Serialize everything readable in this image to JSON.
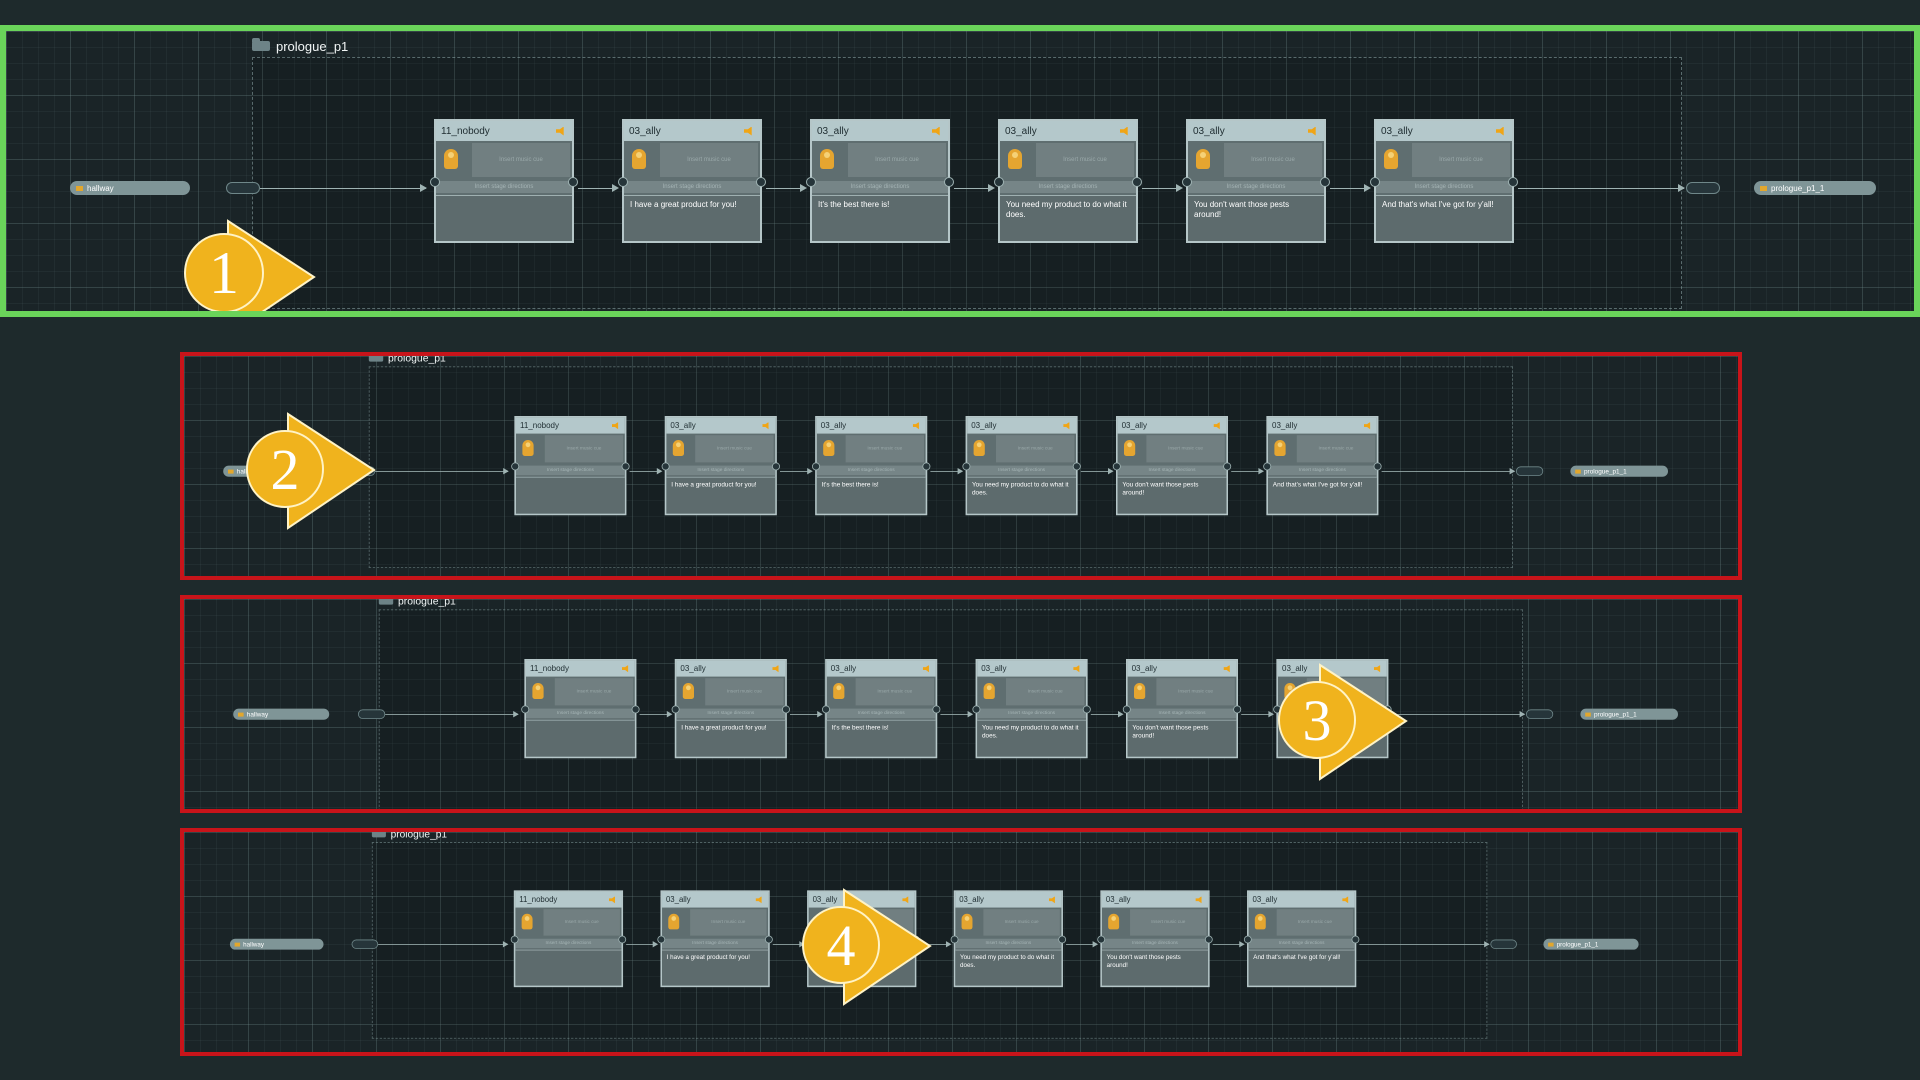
{
  "graph": {
    "group_name": "prologue_p1",
    "start_pill": "hallway",
    "end_pill": "prologue_p1_1",
    "music_placeholder": "Insert music cue",
    "stage_placeholder": "Insert stage directions",
    "nodes": [
      {
        "speaker": "11_nobody",
        "text": ""
      },
      {
        "speaker": "03_ally",
        "text": "I have a great product for you!"
      },
      {
        "speaker": "03_ally",
        "text": "It's the best there is!"
      },
      {
        "speaker": "03_ally",
        "text": "You need my product to do what it does."
      },
      {
        "speaker": "03_ally",
        "text": "You don't want those pests around!"
      },
      {
        "speaker": "03_ally",
        "text": "And that's what I've got for y'all!"
      }
    ]
  },
  "markers": [
    "1",
    "2",
    "3",
    "4"
  ],
  "colors": {
    "selected_border": "#6ad45a",
    "error_border": "#c8141a",
    "marker": "#f0b31d"
  }
}
